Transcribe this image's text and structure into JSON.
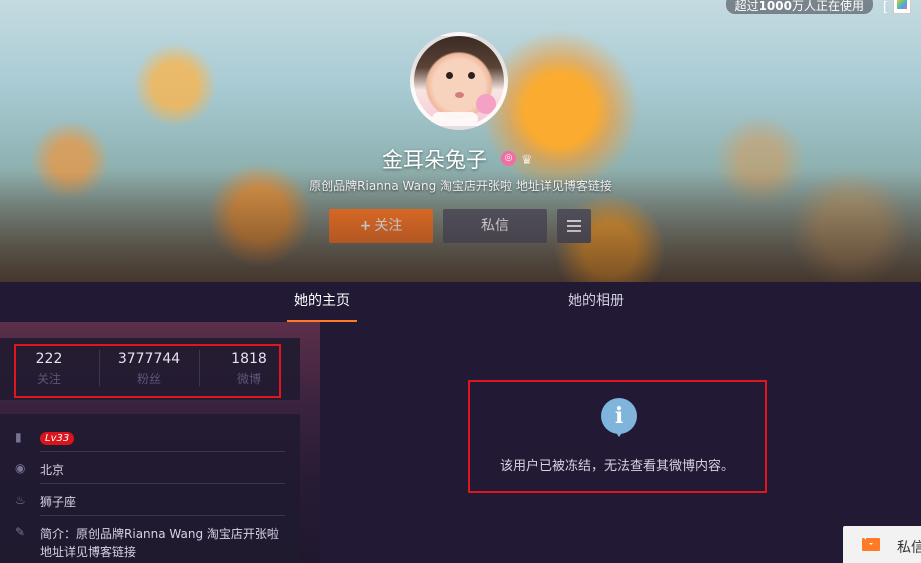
{
  "header": {
    "users_badge_prefix": "超过",
    "users_badge_number": "1000",
    "users_badge_suffix": "万人正在使用",
    "corner_bracket": "[",
    "name": "金耳朵兔子",
    "bio": "原创品牌Rianna Wang 淘宝店开张啦 地址详见博客链接",
    "follow_label": "关注",
    "follow_plus": "+",
    "message_label": "私信"
  },
  "tabs": [
    {
      "label": "她的主页",
      "active": true
    },
    {
      "label": "她的相册",
      "active": false
    }
  ],
  "stats": [
    {
      "value": "222",
      "label": "关注"
    },
    {
      "value": "3777744",
      "label": "粉丝"
    },
    {
      "value": "1818",
      "label": "微博"
    }
  ],
  "info": {
    "level": "Lv33",
    "city": "北京",
    "zodiac": "狮子座",
    "intro_label": "简介：",
    "intro_line1": "原创品牌Rianna Wang 淘宝店开张啦",
    "intro_line2": "地址详见博客链接"
  },
  "notice": {
    "text": "该用户已被冻结，无法查看其微博内容。"
  },
  "chat": {
    "label": "私信"
  },
  "colors": {
    "accent": "#ff7926",
    "page_bg": "#221a35",
    "highlight_box": "#e0161f",
    "level_badge": "#d9141d",
    "info_icon": "#7fb4dc"
  },
  "icons": [
    "crown-icon",
    "verified-icon",
    "bookmark-icon",
    "location-icon",
    "cake-icon",
    "edit-icon",
    "info-icon",
    "mail-icon",
    "menu-icon",
    "app-logo-icon"
  ]
}
